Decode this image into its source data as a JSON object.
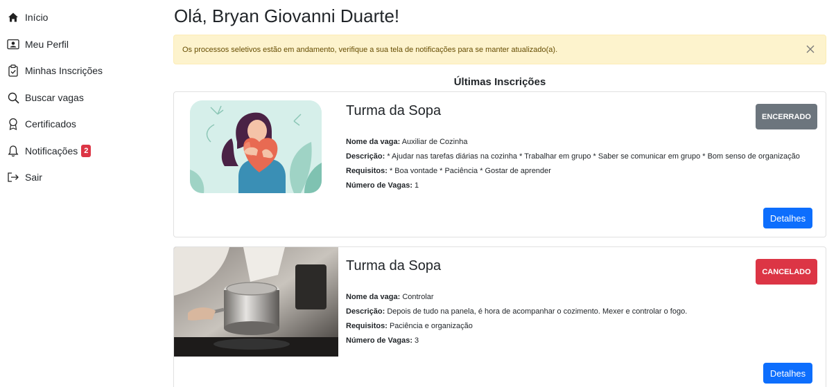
{
  "sidebar": {
    "items": [
      {
        "label": "Início",
        "icon": "home-icon"
      },
      {
        "label": "Meu Perfil",
        "icon": "profile-icon"
      },
      {
        "label": "Minhas Inscrições",
        "icon": "clipboard-check-icon"
      },
      {
        "label": "Buscar vagas",
        "icon": "search-icon"
      },
      {
        "label": "Certificados",
        "icon": "award-icon"
      },
      {
        "label": "Notificações",
        "icon": "bell-icon",
        "badge": "2"
      },
      {
        "label": "Sair",
        "icon": "logout-icon"
      }
    ]
  },
  "main": {
    "greeting": "Olá, Bryan Giovanni Duarte!",
    "alert": "Os processos seletivos estão em andamento, verifique a sua tela de notificações para se manter atualizado(a).",
    "section_title": "Últimas Inscrições",
    "labels": {
      "vaga": "Nome da vaga:",
      "descricao": "Descrição:",
      "requisitos": "Requisitos:",
      "numero": "Número de Vagas:"
    },
    "cards": [
      {
        "title": "Turma da Sopa",
        "status": "ENCERRADO",
        "vaga": "Auxiliar de Cozinha",
        "descricao": "* Ajudar nas tarefas diárias na cozinha * Trabalhar em grupo * Saber se comunicar em grupo * Bom senso de organização",
        "requisitos": "* Boa vontade * Paciência * Gostar de aprender",
        "numero": "1",
        "button": "Detalhes"
      },
      {
        "title": "Turma da Sopa",
        "status": "CANCELADO",
        "vaga": "Controlar",
        "descricao": "Depois de tudo na panela, é hora de acompanhar o cozimento. Mexer e controlar o fogo.",
        "requisitos": "Paciência e organização",
        "numero": "3",
        "button": "Detalhes"
      }
    ]
  },
  "colors": {
    "primary": "#0d6efd",
    "secondary": "#6c757d",
    "danger": "#dc3545",
    "alert_bg": "#fdf3cd",
    "alert_text": "#664d03"
  }
}
